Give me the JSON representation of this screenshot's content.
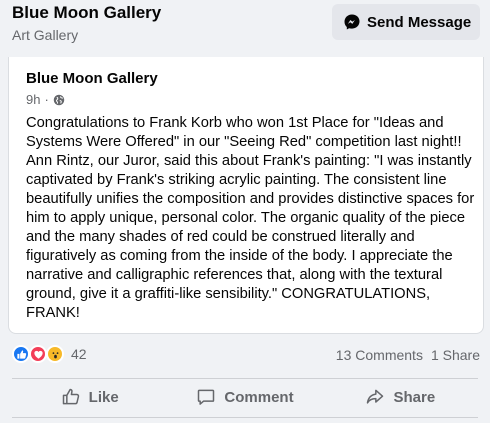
{
  "header": {
    "page_name": "Blue Moon Gallery",
    "category": "Art Gallery",
    "send_message_label": "Send Message"
  },
  "post": {
    "author": "Blue Moon Gallery",
    "time": "9h",
    "dot": "·",
    "audience_icon": "globe-icon",
    "text": "Congratulations to Frank Korb who won 1st Place for \"Ideas and Systems Were Offered\" in our \"Seeing Red\" competition last night!! Ann Rintz, our Juror, said this about Frank's painting: \"I was instantly captivated by Frank's striking acrylic painting. The consistent line beautifully unifies the composition and provides distinctive spaces for him to apply unique, personal color. The organic quality of the piece and the many shades of red could be construed literally and figuratively as coming from the inside of the body. I appreciate the narrative and calligraphic references that, along with the textural ground, give it a graffiti-like sensibility.\" CONGRATULATIONS, FRANK!"
  },
  "engagement": {
    "reaction_icons": [
      "like-icon",
      "love-icon",
      "wow-icon"
    ],
    "reaction_count": "42",
    "comments": "13 Comments",
    "shares": "1 Share"
  },
  "actions": {
    "like": "Like",
    "comment": "Comment",
    "share": "Share"
  },
  "colors": {
    "brand_blue": "#1877f2",
    "love_red": "#f33e58",
    "wow_yellow": "#f7b928",
    "secondary_text": "#65676b"
  }
}
